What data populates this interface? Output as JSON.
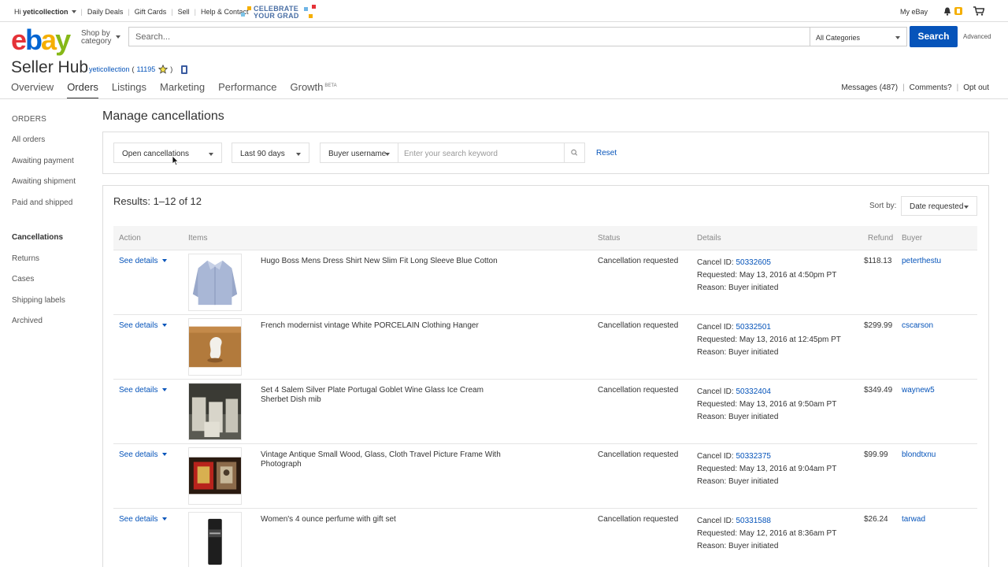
{
  "topbar": {
    "greeting": "Hi",
    "username": "yeticollection",
    "links": [
      "Daily Deals",
      "Gift Cards",
      "Sell",
      "Help & Contact"
    ],
    "promo_line1": "CELEBRATE",
    "promo_line2": "YOUR GRAD",
    "my_ebay": "My eBay"
  },
  "header": {
    "shop_by_line1": "Shop by",
    "shop_by_line2": "category",
    "search_placeholder": "Search...",
    "category": "All Categories",
    "search_button": "Search",
    "advanced": "Advanced"
  },
  "hub": {
    "title": "Seller Hub",
    "user": "yeticollection",
    "feedback": "11195",
    "open_paren": "(",
    "close_paren": ")"
  },
  "nav": {
    "tabs": [
      "Overview",
      "Orders",
      "Listings",
      "Marketing",
      "Performance",
      "Growth"
    ],
    "beta": "BETA",
    "messages": "Messages (487)",
    "comments": "Comments?",
    "opt_out": "Opt out"
  },
  "sidebar": {
    "header": "ORDERS",
    "items": [
      "All orders",
      "Awaiting payment",
      "Awaiting shipment",
      "Paid and shipped",
      "Cancellations",
      "Returns",
      "Cases",
      "Shipping labels",
      "Archived"
    ]
  },
  "main": {
    "title": "Manage cancellations",
    "filter_status": "Open cancellations",
    "filter_period": "Last 90 days",
    "filter_field": "Buyer username",
    "keyword_placeholder": "Enter your search keyword",
    "reset": "Reset",
    "results": "Results: 1–12 of 12",
    "sort_label": "Sort by:",
    "sort_value": "Date requested"
  },
  "table": {
    "headers": [
      "Action",
      "Items",
      "Status",
      "Details",
      "Refund",
      "Buyer"
    ],
    "action_label": "See details",
    "cancel_label": "Cancel ID:",
    "rows": [
      {
        "item": "Hugo Boss Mens Dress Shirt New Slim Fit Long Sleeve Blue Cotton",
        "status": "Cancellation requested",
        "cancel_id": "50332605",
        "requested": "Requested: May 13, 2016 at 4:50pm PT",
        "reason": "Reason: Buyer initiated",
        "refund": "$118.13",
        "buyer": "peterthestu"
      },
      {
        "item": "French modernist vintage White PORCELAIN Clothing Hanger",
        "status": "Cancellation requested",
        "cancel_id": "50332501",
        "requested": "Requested: May 13, 2016 at 12:45pm PT",
        "reason": "Reason: Buyer initiated",
        "refund": "$299.99",
        "buyer": "cscarson"
      },
      {
        "item": "Set 4 Salem Silver Plate Portugal Goblet Wine Glass Ice Cream Sherbet Dish mib",
        "status": "Cancellation requested",
        "cancel_id": "50332404",
        "requested": "Requested: May 13, 2016 at 9:50am PT",
        "reason": "Reason: Buyer initiated",
        "refund": "$349.49",
        "buyer": "waynew5"
      },
      {
        "item": "Vintage Antique Small Wood, Glass, Cloth Travel Picture Frame With Photograph",
        "status": "Cancellation requested",
        "cancel_id": "50332375",
        "requested": "Requested: May 13, 2016 at 9:04am PT",
        "reason": "Reason: Buyer initiated",
        "refund": "$99.99",
        "buyer": "blondtxnu"
      },
      {
        "item": "Women's 4 ounce perfume with gift set",
        "status": "Cancellation requested",
        "cancel_id": "50331588",
        "requested": "Requested: May 12, 2016 at 8:36am PT",
        "reason": "Reason: Buyer initiated",
        "refund": "$26.24",
        "buyer": "tarwad"
      }
    ]
  },
  "colors": {
    "link": "#0654ba",
    "search_button": "#0654ba",
    "logo_e": "#e53238",
    "logo_b": "#0064d2",
    "logo_a": "#f5af02",
    "logo_y": "#86b817"
  }
}
